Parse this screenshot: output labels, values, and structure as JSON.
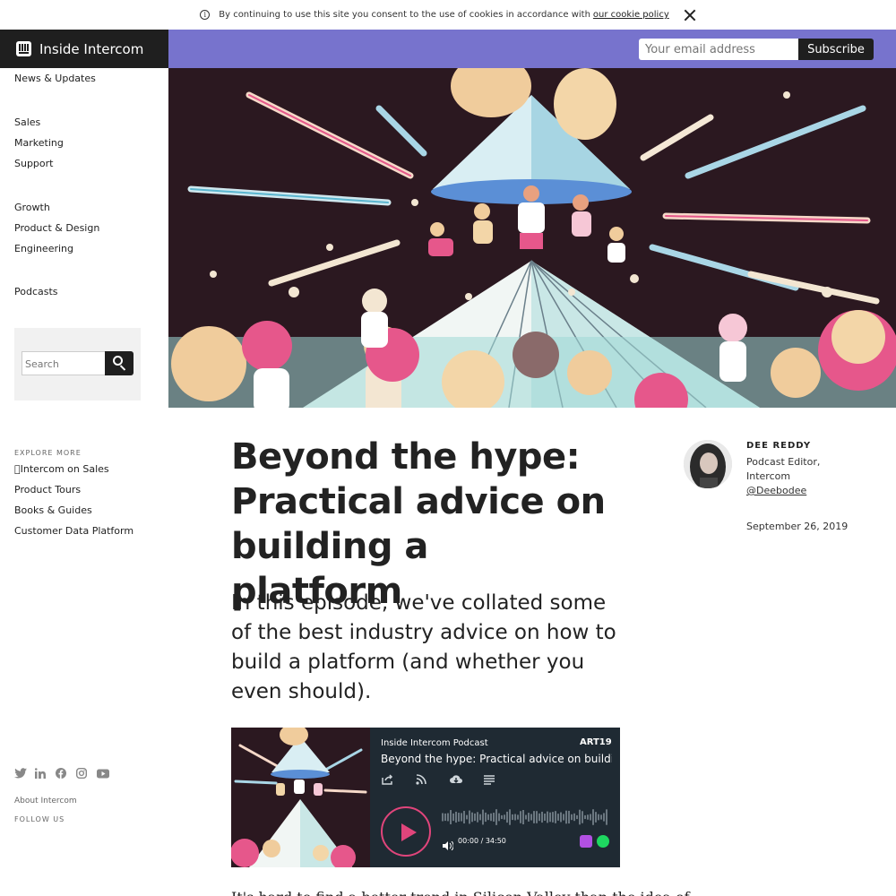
{
  "cookie": {
    "text": "By continuing to use this site you consent to the use of cookies in accordance with",
    "link": "our cookie policy"
  },
  "header": {
    "brand": "Inside Intercom",
    "email_placeholder": "Your email address",
    "subscribe_label": "Subscribe"
  },
  "sidebar": {
    "nav": [
      "News & Updates",
      "Sales",
      "Marketing",
      "Support",
      "Growth",
      "Product & Design",
      "Engineering",
      "Podcasts"
    ],
    "search_placeholder": "Search",
    "explore_label": "EXPLORE MORE",
    "explore": [
      "\u0000Intercom on Sales",
      "Product Tours",
      "Books & Guides",
      "Customer Data Platform"
    ],
    "follow_label": "FOLLOW US",
    "social_icons": [
      "twitter-icon",
      "linkedin-icon",
      "facebook-icon",
      "instagram-icon",
      "youtube-icon"
    ],
    "about": "About Intercom"
  },
  "article": {
    "title": "Beyond the hype: Practical advice on building a platform",
    "lede": "In this episode, we've collated some of the best industry advice on how to build a platform (and whether you even should).",
    "body_start": "It's hard to find a better trend in Silicon Valley than the idea of"
  },
  "author": {
    "name": "DEE REDDY",
    "role": "Podcast Editor, Intercom",
    "handle": "@Deebodee",
    "date": "September 26, 2019"
  },
  "player": {
    "show": "Inside Intercom Podcast",
    "brand": "ART19",
    "episode": "Beyond the hype: Practical advice on building a",
    "time": "00:00 / 34:50",
    "progress": 0,
    "accent": "#e0457b"
  },
  "colors": {
    "brand_bar": "#1f1f1f",
    "subscribe_bar": "#7773cd",
    "player_bg": "#1f2a33"
  }
}
